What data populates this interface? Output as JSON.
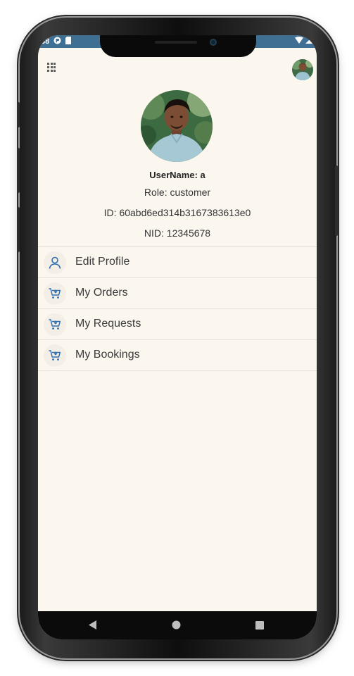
{
  "status_bar": {
    "time_partial": "38",
    "icons": [
      "app-notification-icon",
      "sim-icon",
      "wifi-icon",
      "battery-icon"
    ]
  },
  "app_bar": {
    "menu_icon": "grid-icon",
    "avatar_icon": "user-avatar"
  },
  "profile": {
    "username": "UserName: a",
    "role": "Role: customer",
    "id": "ID: 60abd6ed314b3167383613e0",
    "nid": "NID: 12345678"
  },
  "menu": {
    "items": [
      {
        "label": "Edit Profile",
        "icon": "person-icon"
      },
      {
        "label": "My Orders",
        "icon": "cart-icon"
      },
      {
        "label": "My Requests",
        "icon": "cart-icon"
      },
      {
        "label": "My Bookings",
        "icon": "cart-icon"
      }
    ]
  },
  "nav_bar": {
    "buttons": [
      "back-icon",
      "home-icon",
      "recents-icon"
    ]
  },
  "colors": {
    "status_bar": "#3f6f92",
    "screen_bg": "#fbf7ef",
    "icon_accent": "#2f6fb0"
  }
}
